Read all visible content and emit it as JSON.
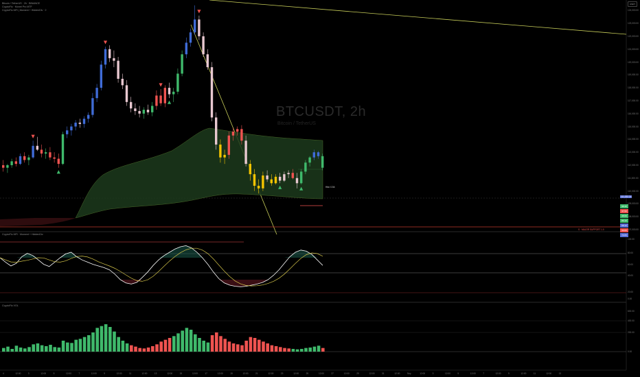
{
  "header": {
    "title_line": "Bitcoin / TetherUS · 2h · BINANCE",
    "indicator1": "CryptoFlo · Monet Pro MTF",
    "indicator2": "CryptoFlo MFI | Moment + HiddenDiv · 2"
  },
  "watermark": {
    "symbol": "BTCUSDT, 2h",
    "sub": "Bitcoin / TetherUS"
  },
  "toolbar": {
    "button_label": "USDT"
  },
  "price_axis": {
    "labels": [
      "124,000.00",
      "123,000.00",
      "122,000.00",
      "121,000.00",
      "120,000.00",
      "119,000.00",
      "118,000.00",
      "117,000.00",
      "116,000.00",
      "115,000.00",
      "114,000.00",
      "113,000.00",
      "112,000.00",
      "111,000.00",
      "110,000.00",
      "109,000.00",
      "108,000.00",
      "107,000.00"
    ],
    "current_price": "111,152.24",
    "small_tag": "Hist: 0.54"
  },
  "level_label": "S · MAJOR SUPPORT 1.0",
  "table_cells": [
    "98.40",
    "37.50",
    "48.60",
    "86.10",
    "68.12",
    "30.00",
    "73.05"
  ],
  "oscillator": {
    "title": "CryptoFlo MFI · Moment + HiddenDiv",
    "axis": [
      "100.00",
      "80.00",
      "60.00",
      "40.00",
      "20.00",
      "0.00"
    ]
  },
  "volume_pane": {
    "title": "CryptoFlo VOL",
    "axis": [
      "600.00",
      "400.00",
      "200.00",
      "0.00"
    ]
  },
  "time_axis": {
    "labels": [
      "4",
      "12:00",
      "3",
      "12:00",
      "5",
      "12:00",
      "7",
      "12:00",
      "9",
      "12:00",
      "11",
      "12:00",
      "13",
      "12:00",
      "15",
      "12:00",
      "17",
      "12:00",
      "19",
      "12:00",
      "21",
      "12:00",
      "23",
      "12:00",
      "25",
      "12:00",
      "27",
      "12:00",
      "29",
      "12:00",
      "31",
      "12:00",
      "Sep",
      "12:00",
      "3",
      "12:00",
      "5",
      "12:00",
      "7",
      "12:00",
      "9",
      "12:00",
      "11",
      "12:00",
      "13"
    ]
  },
  "colors": {
    "bull": "#3fb96b",
    "bear": "#ef5350",
    "blue": "#3f6bd6",
    "pink": "#e8c8d0",
    "yellow": "#f5c400",
    "band": "#1d3a1f",
    "line": "#c9cf5a"
  },
  "candles": [
    [
      112.0,
      112.4,
      111.5,
      111.8
    ],
    [
      111.8,
      112.1,
      111.4,
      112.0
    ],
    [
      112.0,
      112.5,
      111.8,
      112.3
    ],
    [
      112.3,
      112.6,
      111.9,
      112.1
    ],
    [
      112.1,
      112.9,
      112.0,
      112.7
    ],
    [
      112.7,
      113.0,
      112.2,
      112.4
    ],
    [
      112.4,
      112.8,
      112.0,
      112.6
    ],
    [
      112.6,
      113.9,
      112.5,
      113.5
    ],
    [
      113.5,
      114.2,
      113.1,
      113.2
    ],
    [
      113.2,
      113.6,
      112.6,
      112.9
    ],
    [
      112.9,
      113.3,
      112.5,
      113.0
    ],
    [
      113.0,
      113.4,
      112.4,
      112.6
    ],
    [
      112.6,
      113.0,
      112.2,
      112.5
    ],
    [
      112.5,
      112.9,
      111.8,
      112.1
    ],
    [
      112.1,
      114.6,
      112.0,
      114.4
    ],
    [
      114.4,
      115.0,
      114.1,
      114.7
    ],
    [
      114.7,
      115.2,
      114.3,
      115.0
    ],
    [
      115.0,
      115.5,
      114.7,
      115.3
    ],
    [
      115.3,
      115.6,
      114.9,
      115.2
    ],
    [
      115.2,
      115.8,
      114.9,
      115.6
    ],
    [
      115.6,
      116.1,
      115.3,
      115.9
    ],
    [
      115.9,
      117.6,
      115.7,
      117.2
    ],
    [
      117.2,
      118.3,
      116.9,
      118.0
    ],
    [
      118.0,
      120.1,
      117.8,
      119.8
    ],
    [
      119.8,
      121.2,
      119.5,
      121.0
    ],
    [
      121.0,
      121.3,
      120.0,
      120.3
    ],
    [
      120.3,
      120.9,
      119.6,
      120.1
    ],
    [
      120.1,
      120.4,
      118.4,
      118.7
    ],
    [
      118.7,
      119.1,
      117.9,
      118.2
    ],
    [
      118.2,
      118.6,
      116.6,
      116.9
    ],
    [
      116.9,
      117.3,
      116.1,
      116.4
    ],
    [
      116.4,
      116.8,
      115.9,
      116.2
    ],
    [
      116.2,
      116.6,
      115.7,
      116.0
    ],
    [
      116.0,
      116.5,
      115.6,
      116.3
    ],
    [
      116.3,
      116.7,
      115.9,
      116.1
    ],
    [
      116.1,
      116.9,
      115.8,
      116.6
    ],
    [
      116.6,
      117.8,
      116.3,
      117.4
    ],
    [
      117.4,
      117.9,
      116.6,
      116.8
    ],
    [
      116.8,
      118.2,
      116.5,
      118.0
    ],
    [
      118.0,
      118.4,
      117.2,
      117.5
    ],
    [
      117.5,
      118.0,
      116.9,
      117.7
    ],
    [
      117.7,
      119.5,
      117.5,
      119.1
    ],
    [
      119.1,
      120.9,
      118.9,
      120.6
    ],
    [
      120.6,
      121.9,
      120.3,
      121.5
    ],
    [
      121.5,
      122.6,
      121.2,
      122.3
    ],
    [
      122.3,
      124.4,
      122.1,
      123.3
    ],
    [
      123.3,
      123.6,
      121.7,
      122.0
    ],
    [
      122.0,
      122.3,
      120.4,
      120.6
    ],
    [
      120.6,
      121.0,
      119.4,
      119.6
    ],
    [
      119.6,
      120.0,
      115.4,
      115.7
    ],
    [
      115.7,
      116.1,
      113.2,
      113.6
    ],
    [
      113.6,
      114.0,
      112.2,
      112.6
    ],
    [
      112.6,
      113.2,
      112.1,
      112.8
    ],
    [
      112.8,
      114.6,
      112.5,
      114.3
    ],
    [
      114.3,
      114.9,
      113.9,
      114.6
    ],
    [
      114.6,
      115.0,
      114.3,
      114.8
    ],
    [
      114.8,
      115.1,
      113.6,
      113.9
    ],
    [
      113.9,
      114.3,
      111.9,
      112.1
    ],
    [
      112.1,
      112.4,
      110.8,
      111.3
    ],
    [
      111.3,
      111.7,
      110.0,
      110.4
    ],
    [
      110.4,
      110.9,
      109.8,
      110.2
    ],
    [
      110.2,
      111.5,
      110.0,
      111.2
    ],
    [
      111.2,
      111.6,
      110.7,
      110.9
    ],
    [
      110.9,
      111.3,
      110.4,
      110.6
    ],
    [
      110.6,
      111.3,
      110.5,
      111.1
    ],
    [
      111.1,
      111.4,
      110.6,
      110.8
    ],
    [
      110.8,
      111.5,
      110.7,
      111.3
    ],
    [
      111.3,
      111.6,
      111.0,
      111.4
    ],
    [
      111.4,
      111.7,
      110.9,
      111.0
    ],
    [
      111.0,
      111.4,
      110.2,
      110.6
    ],
    [
      110.6,
      111.7,
      110.5,
      111.5
    ],
    [
      111.5,
      112.4,
      111.3,
      112.2
    ],
    [
      112.2,
      112.7,
      111.9,
      112.6
    ],
    [
      112.6,
      113.2,
      112.4,
      113.0
    ],
    [
      113.0,
      113.1,
      112.5,
      112.7
    ],
    [
      112.7,
      112.9,
      111.6,
      111.8
    ]
  ],
  "candle_colors": [
    "bear",
    "bull",
    "bull",
    "bear",
    "blue",
    "bear",
    "bull",
    "blue",
    "pink",
    "bear",
    "bull",
    "bear",
    "bear",
    "bear",
    "bull",
    "blue",
    "blue",
    "blue",
    "pink",
    "blue",
    "blue",
    "blue",
    "blue",
    "blue",
    "blue",
    "pink",
    "pink",
    "pink",
    "pink",
    "pink",
    "pink",
    "pink",
    "pink",
    "bull",
    "pink",
    "bull",
    "bear",
    "bear",
    "bear",
    "pink",
    "bull",
    "bull",
    "bull",
    "blue",
    "blue",
    "blue",
    "pink",
    "pink",
    "pink",
    "pink",
    "pink",
    "yellow",
    "yellow",
    "bear",
    "bear",
    "bear",
    "bear",
    "pink",
    "yellow",
    "yellow",
    "yellow",
    "yellow",
    "pink",
    "yellow",
    "yellow",
    "pink",
    "pink",
    "pink",
    "bear",
    "pink",
    "bull",
    "bull",
    "bull",
    "blue",
    "blue",
    "bull"
  ],
  "volume": [
    40,
    55,
    30,
    65,
    45,
    35,
    50,
    80,
    90,
    70,
    60,
    75,
    50,
    45,
    120,
    100,
    95,
    130,
    140,
    160,
    180,
    210,
    260,
    280,
    300,
    270,
    220,
    160,
    120,
    90,
    70,
    55,
    40,
    35,
    45,
    60,
    80,
    110,
    130,
    150,
    170,
    200,
    230,
    260,
    240,
    190,
    150,
    120,
    100,
    180,
    210,
    170,
    140,
    110,
    90,
    80,
    70,
    120,
    160,
    150,
    130,
    110,
    90,
    70,
    60,
    50,
    40,
    35,
    30,
    25,
    30,
    40,
    45,
    55,
    65,
    40
  ],
  "volume_colors": [
    "bull",
    "bull",
    "bull",
    "bull",
    "bull",
    "bull",
    "bull",
    "bull",
    "bull",
    "bull",
    "bull",
    "bull",
    "bull",
    "bull",
    "bull",
    "bull",
    "bull",
    "bull",
    "bull",
    "bull",
    "bull",
    "bull",
    "bull",
    "bull",
    "bull",
    "bull",
    "bull",
    "bull",
    "bull",
    "bull",
    "bear",
    "bear",
    "bear",
    "bear",
    "bear",
    "bear",
    "bear",
    "bear",
    "bear",
    "bear",
    "bull",
    "bull",
    "bull",
    "bull",
    "bull",
    "bull",
    "bull",
    "bull",
    "bull",
    "bear",
    "bear",
    "bear",
    "bear",
    "bear",
    "bear",
    "bear",
    "bear",
    "bear",
    "bear",
    "bear",
    "bear",
    "bear",
    "bear",
    "bear",
    "bear",
    "bear",
    "bear",
    "bear",
    "bull",
    "bull",
    "bull",
    "bull",
    "bull",
    "bull",
    "bull",
    "bear"
  ],
  "mfi": [
    70,
    62,
    55,
    60,
    72,
    78,
    74,
    66,
    58,
    54,
    62,
    70,
    77,
    80,
    72,
    66,
    62,
    58,
    55,
    52,
    48,
    40,
    30,
    24,
    22,
    25,
    34,
    44,
    56,
    66,
    74,
    80,
    86,
    90,
    92,
    88,
    80,
    70,
    58,
    44,
    32,
    24,
    20,
    18,
    17,
    18,
    20,
    22,
    25,
    30,
    38,
    48,
    60,
    72,
    80,
    84,
    82,
    76,
    66,
    56
  ]
}
